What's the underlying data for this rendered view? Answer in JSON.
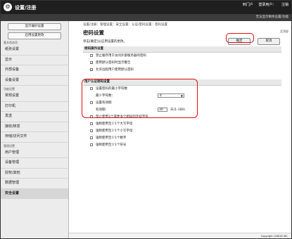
{
  "app": {
    "title": "设置/注册",
    "logo": "⚙",
    "top_links": [
      "到门户",
      "登录用户：",
      "注销"
    ],
    "info": "无法显示剩余设置/功能"
  },
  "sidebar": {
    "buttons": [
      "显示偏好设置",
      "启用设置更改"
    ],
    "groups": [
      {
        "head": "基本首选项",
        "items": [
          "纸张设置",
          "显示",
          "外部设备",
          "设备设置"
        ]
      },
      {
        "head": "功能设置",
        "items": [
          "常规设置",
          "打印机",
          "发送",
          "接收/转发",
          "存储/访问文件"
        ]
      },
      {
        "head": "管理设置",
        "items": [
          "用户管理",
          "设备管理",
          "授权/其他",
          "数据管理",
          "安全设置"
        ]
      }
    ],
    "active": "安全设置"
  },
  "main": {
    "breadcrumb": "设置/注册：管理设置：安全设置：认证/密码设置：密码设置",
    "title": "密码设置",
    "back_link": "至顶部",
    "notice": "单击[确定]以应用设置的更改。",
    "ok_label": "确定",
    "cancel_label": "取消",
    "section1": {
      "title": "密码操作设置",
      "rows": [
        {
          "label": "禁止缓存用于访问外部服务器的密码",
          "checked": false
        },
        {
          "label": "使用默认密码时显示警告",
          "checked": true
        },
        {
          "label": "允许远程用户使用默认密码",
          "checked": true
        }
      ]
    },
    "section2": {
      "title": "用户认证密码设置",
      "min_len_enable": "设置密码的最小字符数",
      "min_len_enable_checked": false,
      "min_len_label": "最少字符数：",
      "min_len_value": "4",
      "expiry_enable": "设置有效期",
      "expiry_enable_checked": false,
      "expiry_label": "有效期：",
      "expiry_value": "30",
      "expiry_unit": "天(1-180)",
      "rules": [
        "禁止使用3个或更多个相同的连续字符",
        "强制使用至少1个大写字母",
        "强制使用至少1个小写字母",
        "强制使用至少1个数字",
        "强制使用至少1个符号"
      ]
    }
  },
  "footer": "Copyright CANON INC."
}
